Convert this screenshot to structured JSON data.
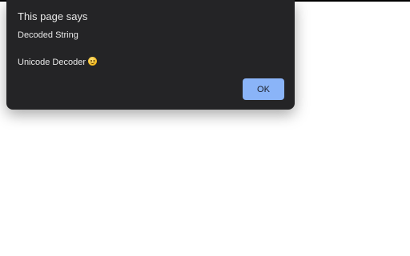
{
  "dialog": {
    "title": "This page says",
    "message_lines": [
      "Decoded String",
      "Unicode Decoder"
    ],
    "message_emoji": "grinning-face-icon",
    "ok_label": "OK"
  },
  "colors": {
    "dialog_background": "#242426",
    "dialog_text": "#e8e8e8",
    "button_background": "#8ab4f8"
  }
}
